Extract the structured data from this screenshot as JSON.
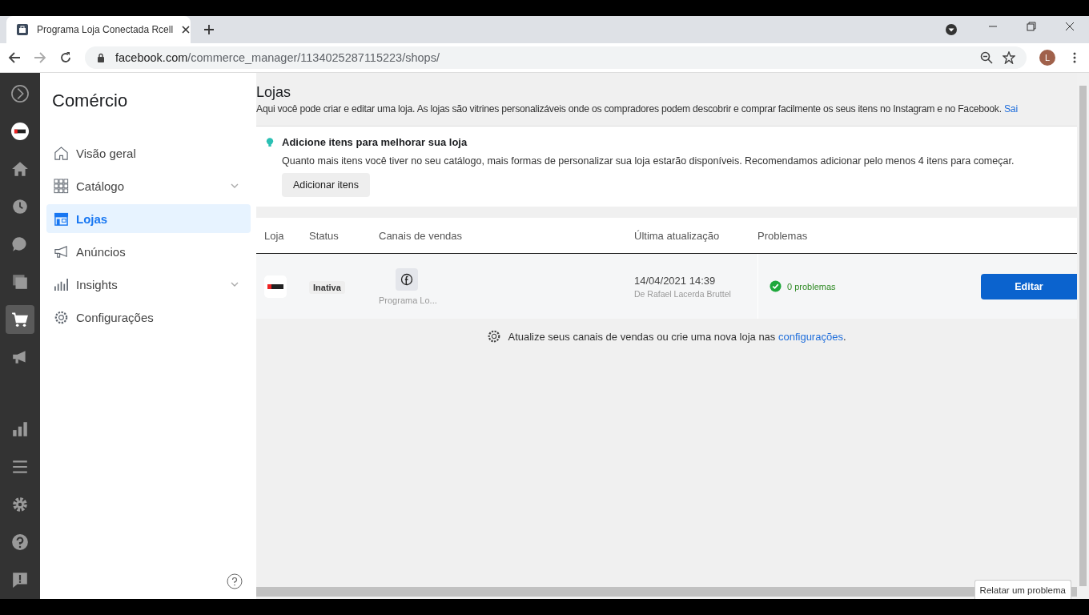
{
  "browser": {
    "tab_title": "Programa Loja Conectada Rcell",
    "url_host": "facebook.com",
    "url_path": "/commerce_manager/1134025287115223/shops/",
    "profile_initial": "L"
  },
  "rail_items": [
    {
      "selected": false
    },
    {
      "selected": false
    },
    {
      "selected": false
    },
    {
      "selected": false
    },
    {
      "selected": false
    },
    {
      "selected": false
    },
    {
      "selected": true
    },
    {
      "selected": false
    },
    {
      "selected": false
    },
    {
      "selected": false
    }
  ],
  "sidebar": {
    "title": "Comércio",
    "items": [
      {
        "label": "Visão geral",
        "selected": false,
        "expandable": false
      },
      {
        "label": "Catálogo",
        "selected": false,
        "expandable": true
      },
      {
        "label": "Lojas",
        "selected": true,
        "expandable": false
      },
      {
        "label": "Anúncios",
        "selected": false,
        "expandable": false
      },
      {
        "label": "Insights",
        "selected": false,
        "expandable": true
      },
      {
        "label": "Configurações",
        "selected": false,
        "expandable": false
      }
    ]
  },
  "page": {
    "title": "Lojas",
    "description": "Aqui você pode criar e editar uma loja. As lojas são vitrines personalizáveis onde os compradores podem descobrir e comprar facilmente os seus itens no Instagram e no Facebook.",
    "description_link": "Sai"
  },
  "tip": {
    "title": "Adicione itens para melhorar sua loja",
    "text": "Quanto mais itens você tiver no seu catálogo, mais formas de personalizar sua loja estarão disponíveis. Recomendamos adicionar pelo menos 4 itens para começar.",
    "button": "Adicionar itens"
  },
  "table": {
    "columns": [
      "Loja",
      "Status",
      "Canais de vendas",
      "Última atualização",
      "Problemas"
    ],
    "rows": [
      {
        "status": "Inativa",
        "channel": "Programa Lo...",
        "updated": "14/04/2021 14:39",
        "updated_by": "De Rafael Lacerda Bruttel",
        "problems": "0 problemas",
        "action": "Editar"
      }
    ]
  },
  "footer_note": {
    "text": "Atualize seus canais de vendas ou crie uma nova loja nas",
    "link": "configurações",
    "end": "."
  },
  "report_button": "Relatar um problema"
}
